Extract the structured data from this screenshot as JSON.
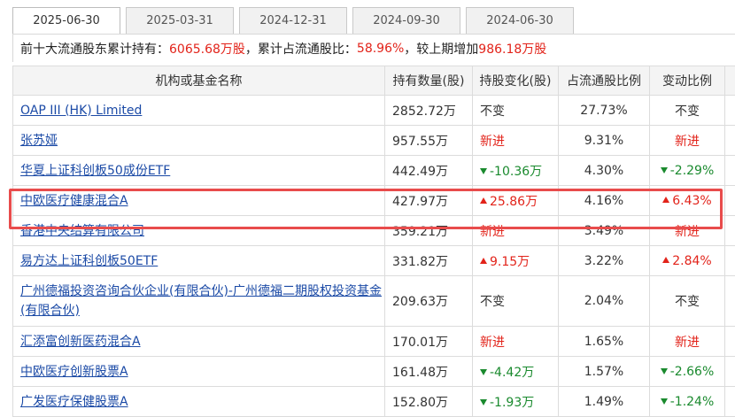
{
  "tabs": [
    {
      "label": "2025-06-30",
      "active": true
    },
    {
      "label": "2025-03-31",
      "active": false
    },
    {
      "label": "2024-12-31",
      "active": false
    },
    {
      "label": "2024-09-30",
      "active": false
    },
    {
      "label": "2024-06-30",
      "active": false
    }
  ],
  "summary": {
    "prefix": "前十大流通股东累计持有：",
    "hold": "6065.68万股",
    "mid": "，累计占流通股比：",
    "ratio": "58.96%",
    "tail": "，较上期增加",
    "increase": "986.18万股"
  },
  "table": {
    "headers": [
      "机构或基金名称",
      "持有数量(股)",
      "持股变化(股)",
      "占流通股比例",
      "变动比例"
    ],
    "rows": [
      {
        "name": "OAP III (HK) Limited",
        "qty": "2852.72万",
        "change": "不变",
        "change_dir": "none",
        "ratio": "27.73%",
        "vary": "不变",
        "vary_dir": "none"
      },
      {
        "name": "张苏娅",
        "qty": "957.55万",
        "change": "新进",
        "change_dir": "new",
        "ratio": "9.31%",
        "vary": "新进",
        "vary_dir": "new"
      },
      {
        "name": "华夏上证科创板50成份ETF",
        "qty": "442.49万",
        "change": "-10.36万",
        "change_dir": "down",
        "ratio": "4.30%",
        "vary": "-2.29%",
        "vary_dir": "down"
      },
      {
        "name": "中欧医疗健康混合A",
        "qty": "427.97万",
        "change": "25.86万",
        "change_dir": "up",
        "ratio": "4.16%",
        "vary": "6.43%",
        "vary_dir": "up"
      },
      {
        "name": "香港中央结算有限公司",
        "qty": "359.21万",
        "change": "新进",
        "change_dir": "new",
        "ratio": "3.49%",
        "vary": "新进",
        "vary_dir": "new"
      },
      {
        "name": "易方达上证科创板50ETF",
        "qty": "331.82万",
        "change": "9.15万",
        "change_dir": "up",
        "ratio": "3.22%",
        "vary": "2.84%",
        "vary_dir": "up"
      },
      {
        "name": "广州德福投资咨询合伙企业(有限合伙)-广州德福二期股权投资基金(有限合伙)",
        "qty": "209.63万",
        "change": "不变",
        "change_dir": "none",
        "ratio": "2.04%",
        "vary": "不变",
        "vary_dir": "none"
      },
      {
        "name": "汇添富创新医药混合A",
        "qty": "170.01万",
        "change": "新进",
        "change_dir": "new",
        "ratio": "1.65%",
        "vary": "新进",
        "vary_dir": "new"
      },
      {
        "name": "中欧医疗创新股票A",
        "qty": "161.48万",
        "change": "-4.42万",
        "change_dir": "down",
        "ratio": "1.57%",
        "vary": "-2.66%",
        "vary_dir": "down"
      },
      {
        "name": "广发医疗保健股票A",
        "qty": "152.80万",
        "change": "-1.93万",
        "change_dir": "down",
        "ratio": "1.49%",
        "vary": "-1.24%",
        "vary_dir": "down"
      }
    ]
  },
  "colors": {
    "red": "#e2231a",
    "green": "#1a8a2e",
    "link": "#1b4aa6",
    "highlight": "#e84c4c"
  }
}
